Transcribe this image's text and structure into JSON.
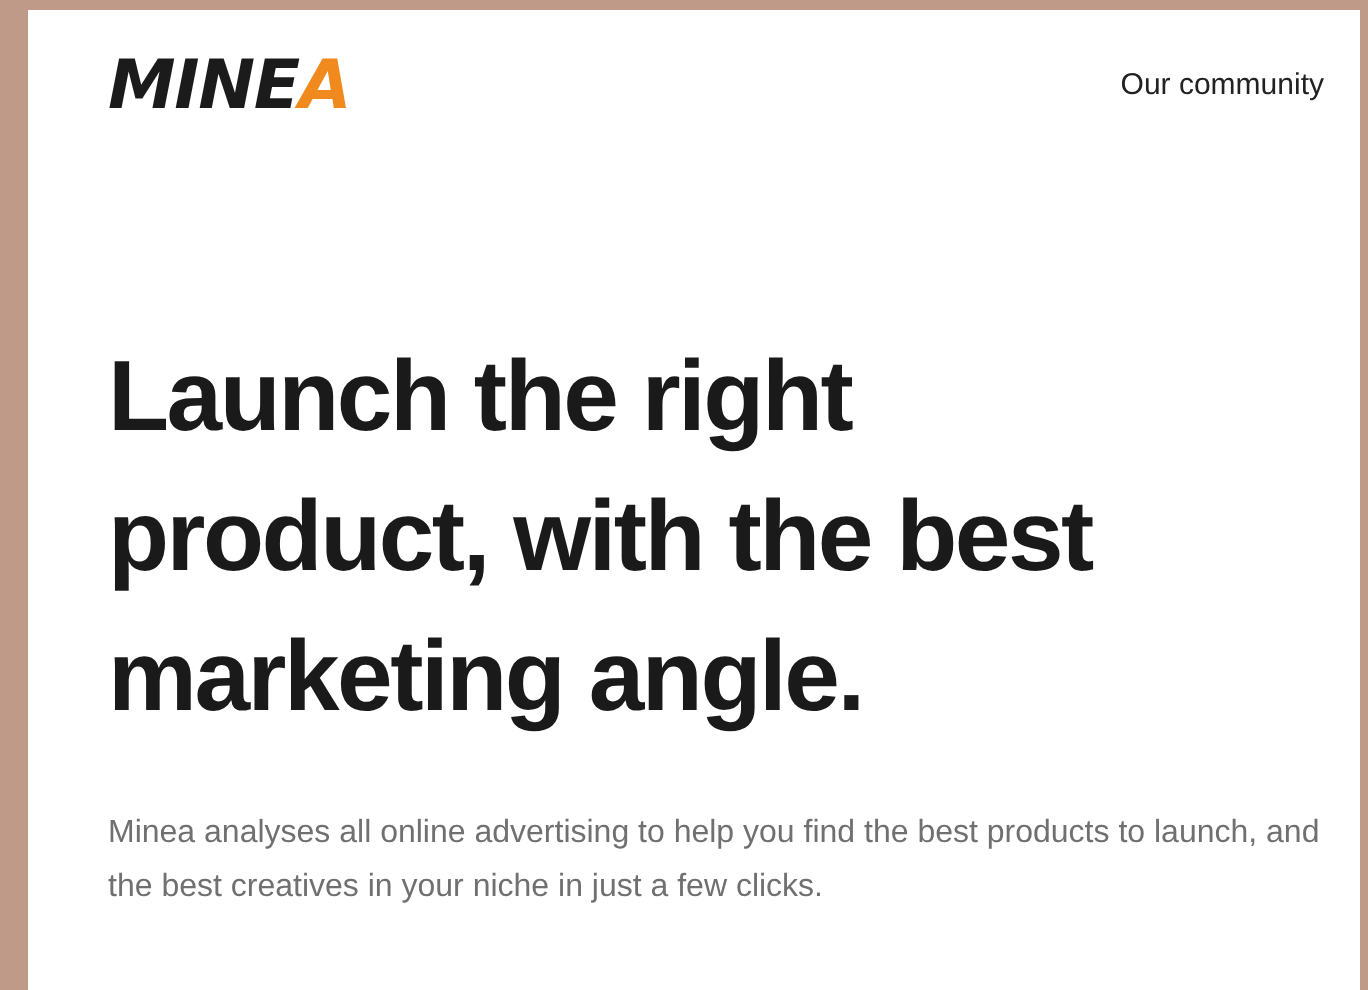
{
  "header": {
    "logo": {
      "text": "MINE",
      "accent": "A"
    },
    "nav": [
      "Our community"
    ]
  },
  "hero": {
    "headline_lines": [
      "Launch the right",
      "product, with the best",
      "marketing angle."
    ],
    "description": "Minea analyses all online advertising to help you find the best products to launch, and the best creatives in your niche in just a few clicks."
  }
}
